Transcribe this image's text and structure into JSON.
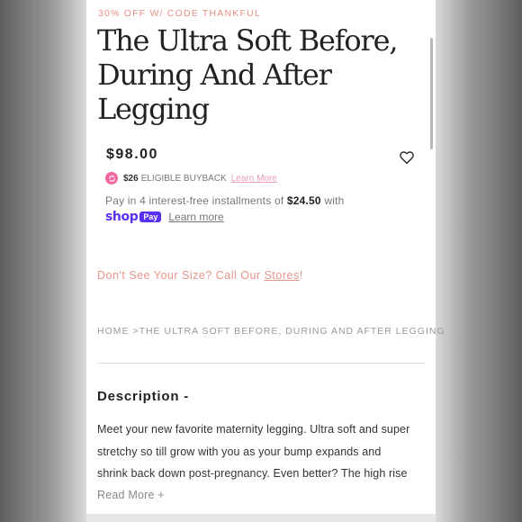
{
  "promo": "30% OFF W/ CODE THANKFUL",
  "product": {
    "title_lines": [
      "The Ultra Soft Before,",
      "During And After",
      "Legging"
    ],
    "price": "$98.00"
  },
  "buyback": {
    "amount": "$26",
    "label": "ELIGIBLE BUYBACK",
    "link": "Learn More"
  },
  "installments": {
    "prefix": "Pay in 4 interest-free installments of",
    "amount": "$24.50",
    "suffix": "with",
    "shop_word": "shop",
    "shop_pay": "Pay",
    "learn_more": "Learn more"
  },
  "size_cta": {
    "text": "Don't See Your Size? Call Our",
    "link": "Stores",
    "suffix": "!"
  },
  "breadcrumb": {
    "home": "HOME",
    "separator": ">",
    "current": "THE ULTRA SOFT BEFORE, DURING AND AFTER LEGGING"
  },
  "description": {
    "heading": "Description -",
    "lines": [
      "Meet your new favorite maternity legging. Ultra soft and super",
      "stretchy so till grow with you as your bump expands and",
      "shrink back down post-pregnancy. Even better? The high rise"
    ],
    "read_more": "Read More +"
  },
  "colors": {
    "promo": "#e88f84",
    "shop_pay": "#5a31f4",
    "buyback_icon": "#f06a9f"
  },
  "icons": [
    "heart-icon",
    "buyback-icon"
  ]
}
